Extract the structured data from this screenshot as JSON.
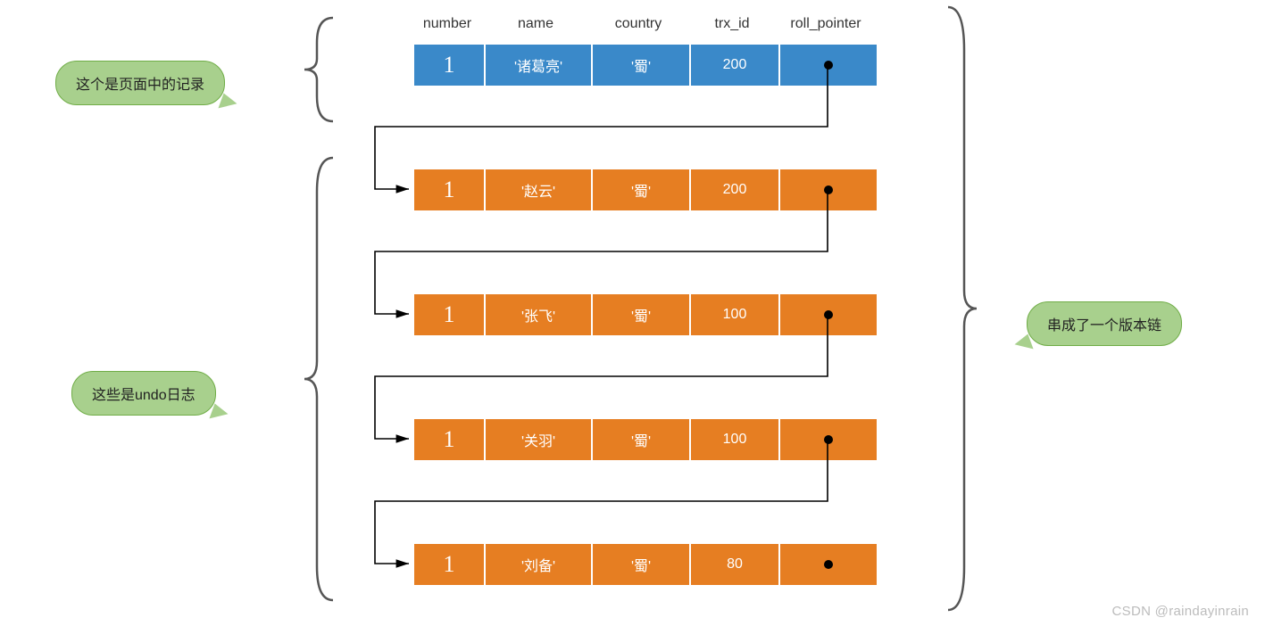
{
  "columns": {
    "number": "number",
    "name": "name",
    "country": "country",
    "trx_id": "trx_id",
    "roll_pointer": "roll_pointer"
  },
  "page_record": {
    "number": "1",
    "name": "'诸葛亮'",
    "country": "'蜀'",
    "trx_id": "200"
  },
  "undo_logs": [
    {
      "number": "1",
      "name": "'赵云'",
      "country": "'蜀'",
      "trx_id": "200"
    },
    {
      "number": "1",
      "name": "'张飞'",
      "country": "'蜀'",
      "trx_id": "100"
    },
    {
      "number": "1",
      "name": "'关羽'",
      "country": "'蜀'",
      "trx_id": "100"
    },
    {
      "number": "1",
      "name": "'刘备'",
      "country": "'蜀'",
      "trx_id": "80"
    }
  ],
  "annotations": {
    "page_record_label": "这个是页面中的记录",
    "undo_label": "这些是undo日志",
    "chain_label": "串成了一个版本链"
  },
  "watermark": "CSDN @raindayinrain"
}
